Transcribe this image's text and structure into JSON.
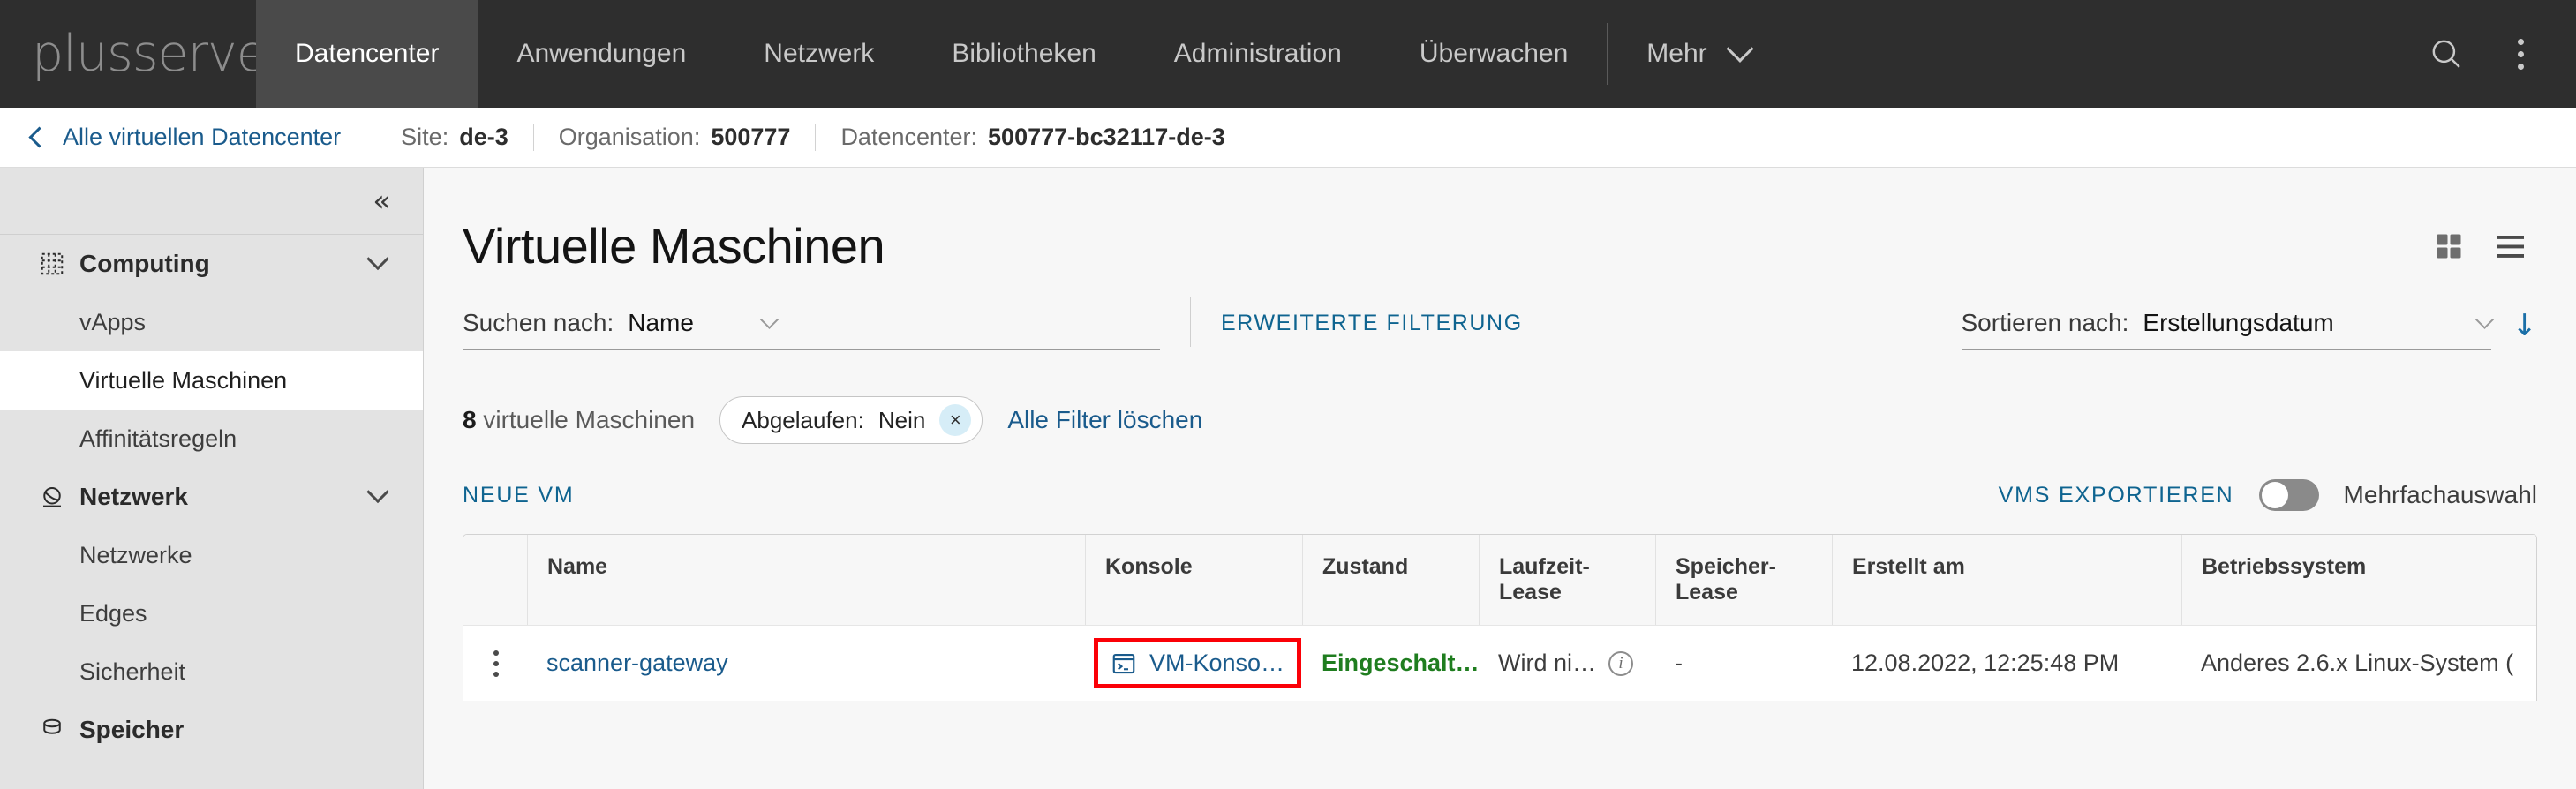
{
  "brand": {
    "logo_text": "plusserver"
  },
  "topnav": {
    "items": [
      {
        "label": "Datencenter",
        "active": true
      },
      {
        "label": "Anwendungen",
        "active": false
      },
      {
        "label": "Netzwerk",
        "active": false
      },
      {
        "label": "Bibliotheken",
        "active": false
      },
      {
        "label": "Administration",
        "active": false
      },
      {
        "label": "Überwachen",
        "active": false
      }
    ],
    "more_label": "Mehr"
  },
  "breadcrumb": {
    "back_label": "Alle virtuellen Datencenter",
    "crumbs": [
      {
        "label": "Site:",
        "value": "de-3"
      },
      {
        "label": "Organisation:",
        "value": "500777"
      },
      {
        "label": "Datencenter:",
        "value": "500777-bc32117-de-3"
      }
    ]
  },
  "sidebar": {
    "groups": [
      {
        "label": "Computing",
        "icon": "grid-icon",
        "items": [
          {
            "label": "vApps",
            "active": false
          },
          {
            "label": "Virtuelle Maschinen",
            "active": true
          },
          {
            "label": "Affinitätsregeln",
            "active": false
          }
        ]
      },
      {
        "label": "Netzwerk",
        "icon": "globe-icon",
        "items": [
          {
            "label": "Netzwerke",
            "active": false
          },
          {
            "label": "Edges",
            "active": false
          },
          {
            "label": "Sicherheit",
            "active": false
          }
        ]
      },
      {
        "label": "Speicher",
        "icon": "database-icon",
        "items": []
      }
    ]
  },
  "main": {
    "title": "Virtuelle Maschinen",
    "search": {
      "label": "Suchen nach:",
      "value": "Name"
    },
    "advanced_filter_label": "ERWEITERTE FILTERUNG",
    "sort": {
      "label": "Sortieren nach:",
      "value": "Erstellungsdatum",
      "direction": "↓"
    },
    "count_number": "8",
    "count_label": "virtuelle Maschinen",
    "filter_chip": {
      "label": "Abgelaufen:",
      "value": "Nein",
      "remove": "×"
    },
    "clear_filters_label": "Alle Filter löschen",
    "new_vm_label": "NEUE VM",
    "export_vms_label": "VMS EXPORTIEREN",
    "multiselect_label": "Mehrfachauswahl"
  },
  "table": {
    "columns": [
      {
        "key": "menu",
        "label": ""
      },
      {
        "key": "name",
        "label": "Name"
      },
      {
        "key": "console",
        "label": "Konsole"
      },
      {
        "key": "state",
        "label": "Zustand"
      },
      {
        "key": "runtime",
        "label": "Laufzeit-\nLease"
      },
      {
        "key": "storage",
        "label": "Speicher-\nLease"
      },
      {
        "key": "created",
        "label": "Erstellt am"
      },
      {
        "key": "os",
        "label": "Betriebssystem"
      }
    ],
    "rows": [
      {
        "name": "scanner-gateway",
        "console": "VM-Konso…",
        "state": "Eingeschalt…",
        "runtime": "Wird ni…",
        "storage": "-",
        "created": "12.08.2022, 12:25:48 PM",
        "os": "Anderes 2.6.x Linux-System ("
      }
    ]
  },
  "colors": {
    "nav_bg": "#2e2e2e",
    "nav_active_bg": "#4a4a4a",
    "link": "#1a5b8c",
    "action_link": "#0f6490",
    "state_on": "#1f7d1f",
    "highlight": "#fb0007",
    "sidebar_bg": "#e3e3e3"
  }
}
